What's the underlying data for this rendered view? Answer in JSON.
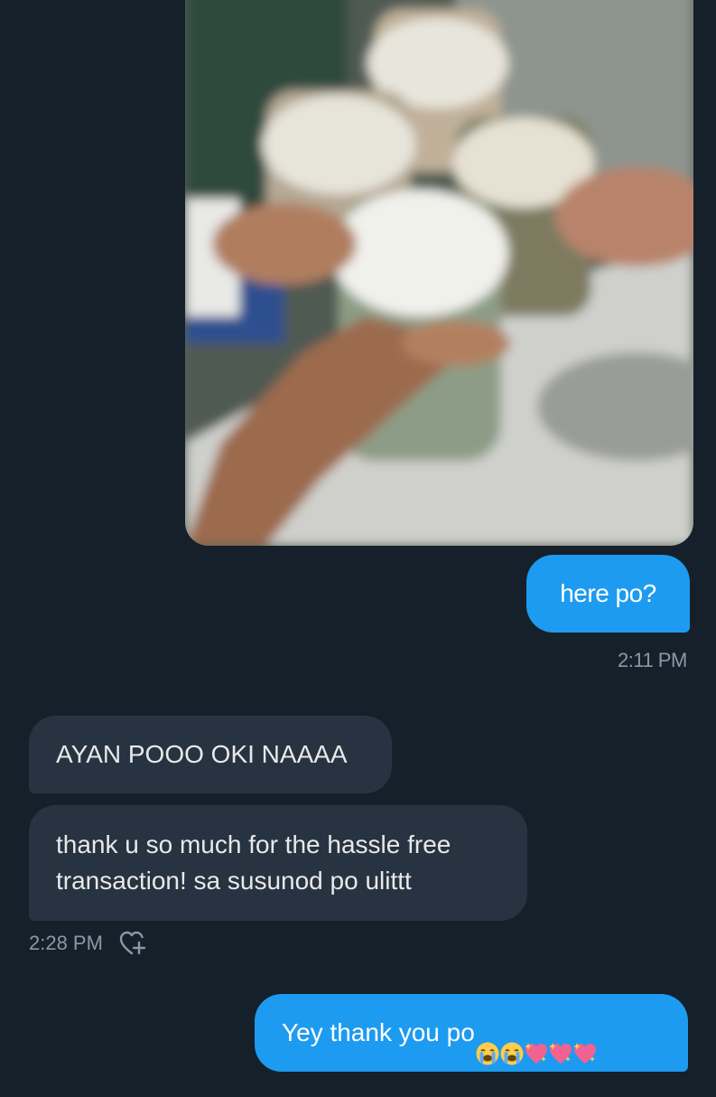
{
  "photo": {
    "icon": "shared-photo"
  },
  "messages": [
    {
      "direction": "outgoing",
      "text": "here po?",
      "time": "2:11 PM"
    },
    {
      "direction": "incoming",
      "text": "AYAN POOO OKI NAAAA"
    },
    {
      "direction": "incoming",
      "text": "thank u so much for the hassle free transaction! sa susunod po ulittt",
      "time": "2:28 PM"
    },
    {
      "direction": "outgoing",
      "text": "Yey thank you po",
      "emojis": [
        "loudly-crying-face",
        "loudly-crying-face",
        "sparkling-heart",
        "sparkling-heart",
        "sparkling-heart"
      ]
    }
  ],
  "icons": {
    "reaction": "add-reaction-heart-icon"
  },
  "colors": {
    "background": "#15202b",
    "outgoing_bubble": "#1d9bf0",
    "incoming_bubble": "#273340",
    "timestamp": "#8b98a5"
  }
}
